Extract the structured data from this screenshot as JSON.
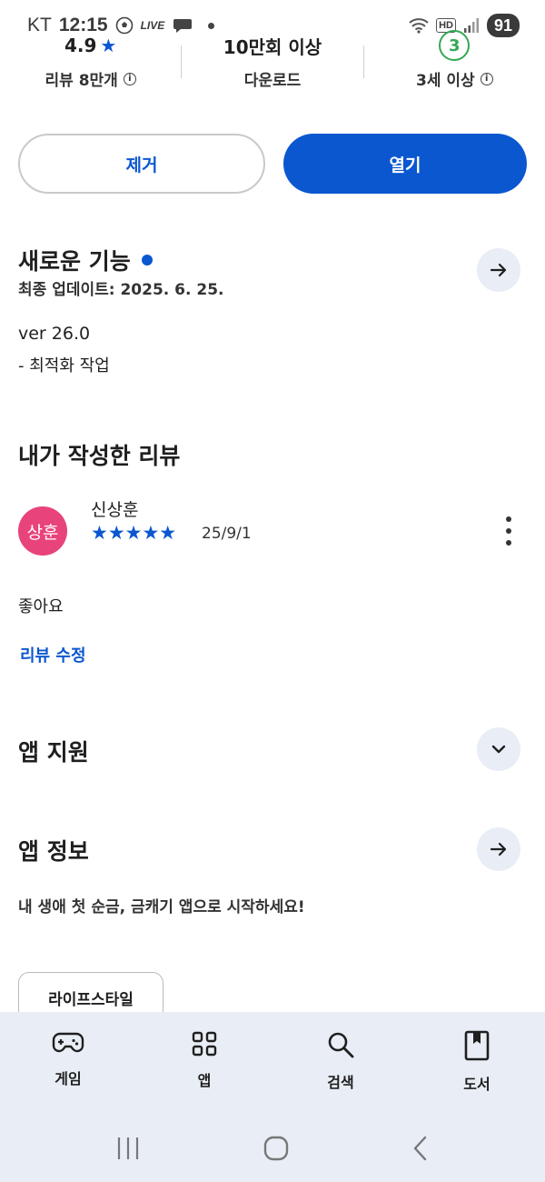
{
  "status_bar": {
    "carrier": "KT",
    "time": "12:15",
    "live": "LIVE",
    "hd": "HD",
    "battery": "91"
  },
  "stats": {
    "rating": "4.9",
    "rating_label": "리뷰 8만개",
    "downloads": "10만회 이상",
    "downloads_label": "다운로드",
    "age": "3",
    "age_label": "3세 이상"
  },
  "actions": {
    "uninstall": "제거",
    "open": "열기"
  },
  "whats_new": {
    "title": "새로운 기능",
    "last_updated": "최종 업데이트: 2025. 6. 25.",
    "version": "ver 26.0",
    "note": "- 최적화 작업"
  },
  "my_review": {
    "title": "내가 작성한 리뷰",
    "avatar_text": "상훈",
    "avatar_color": "#e8437a",
    "reviewer": "신상훈",
    "stars": "★★★★★",
    "rating": 5,
    "date": "25/9/1",
    "body": "좋아요",
    "edit_label": "리뷰 수정"
  },
  "app_support": {
    "title": "앱 지원"
  },
  "app_info": {
    "title": "앱 정보",
    "description": "내 생애 첫 순금, 금캐기 앱으로 시작하세요!",
    "category_chip": "라이프스타일"
  },
  "bottom_nav": {
    "items": [
      {
        "label": "게임",
        "icon": "gamepad-icon"
      },
      {
        "label": "앱",
        "icon": "apps-grid-icon"
      },
      {
        "label": "검색",
        "icon": "search-icon"
      },
      {
        "label": "도서",
        "icon": "book-icon"
      }
    ]
  },
  "colors": {
    "accent": "#0b57d0",
    "age_badge": "#34a853",
    "nav_background": "#e9eef6"
  }
}
